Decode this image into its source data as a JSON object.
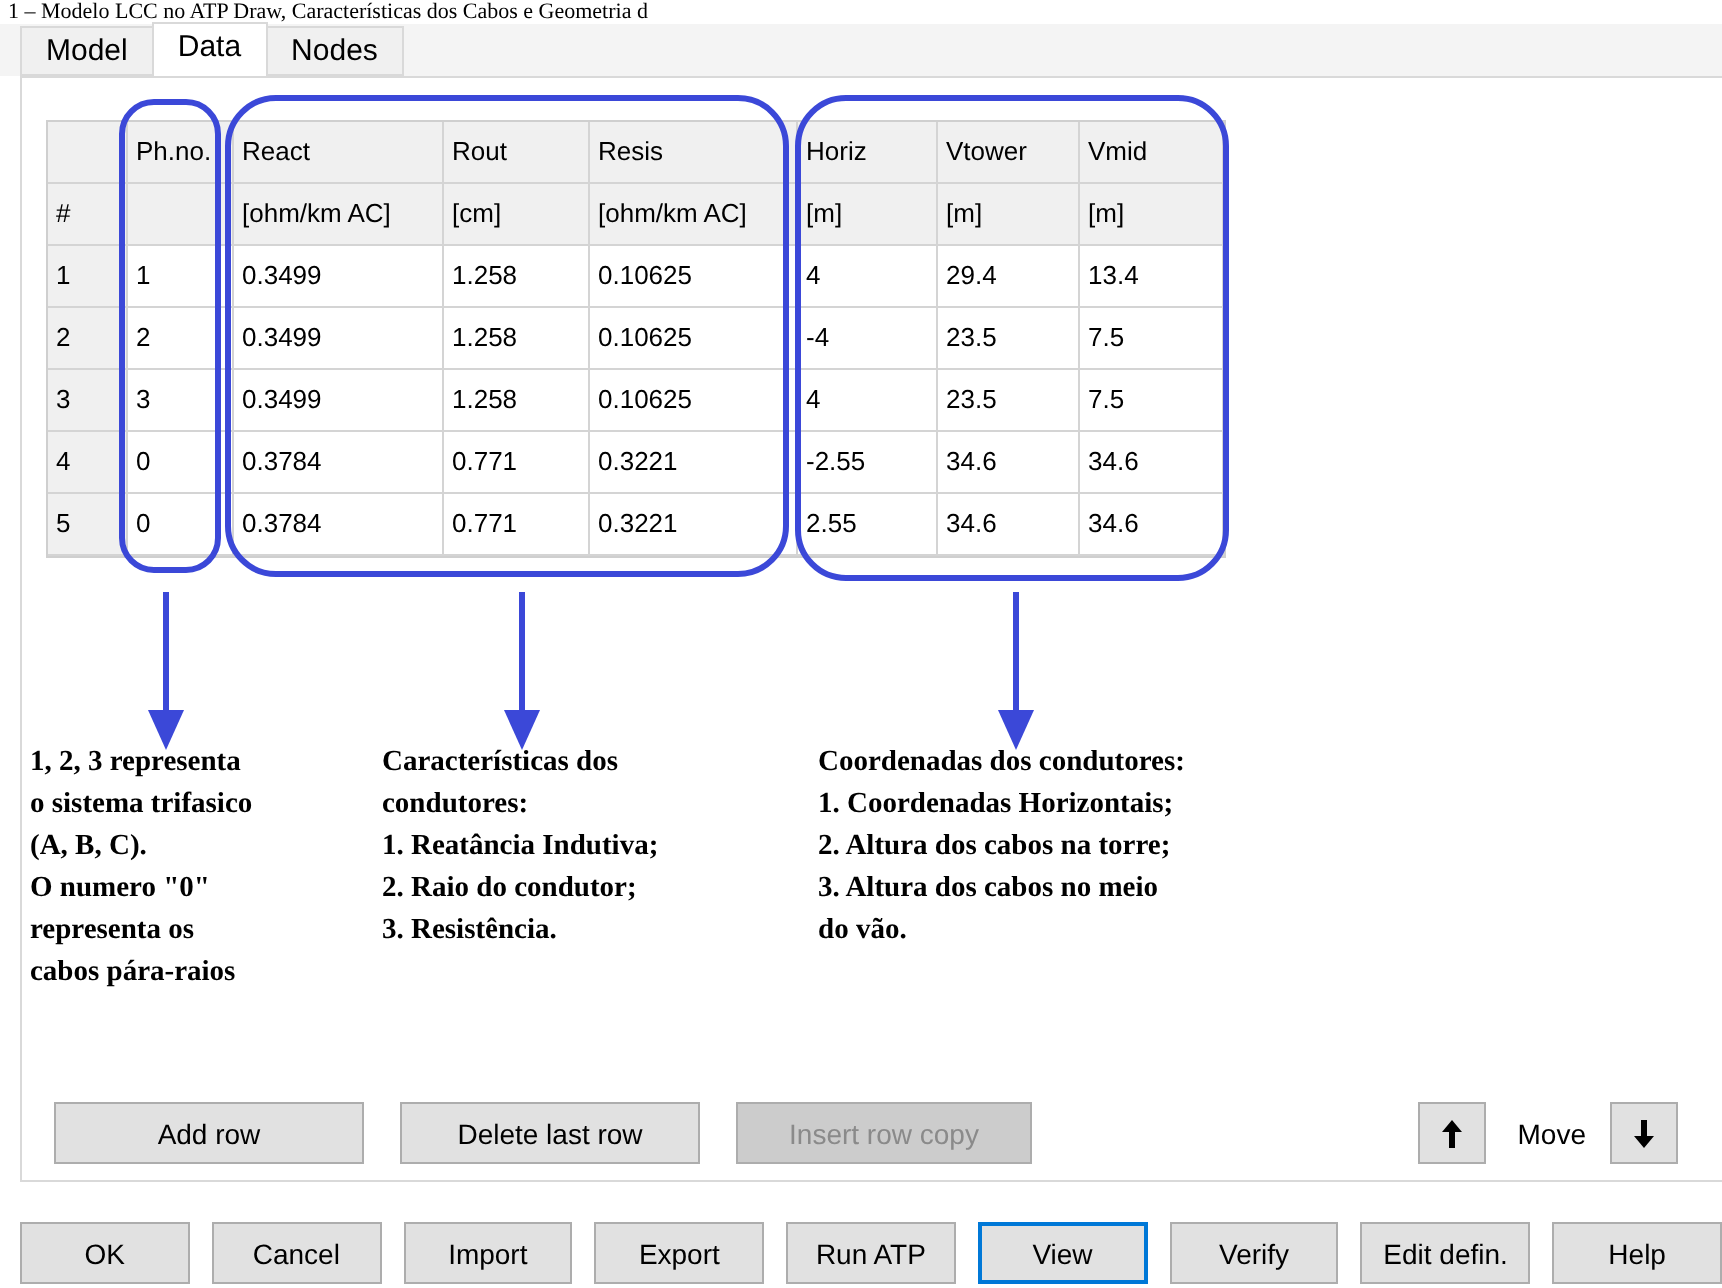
{
  "caption": "1 – Modelo LCC no ATP Draw, Características dos Cabos e Geometria d",
  "tabs": [
    {
      "label": "Model",
      "selected": false
    },
    {
      "label": "Data",
      "selected": true
    },
    {
      "label": "Nodes",
      "selected": false
    }
  ],
  "table": {
    "columns": [
      {
        "subheading": "#"
      },
      {
        "name": "Ph.no."
      },
      {
        "name": "React",
        "subheading": "[ohm/km AC]"
      },
      {
        "name": "Rout",
        "subheading": "[cm]"
      },
      {
        "name": "Resis",
        "subheading": "[ohm/km AC]"
      },
      {
        "name": "Horiz",
        "subheading": "[m]"
      },
      {
        "name": "Vtower",
        "subheading": "[m]"
      },
      {
        "name": "Vmid",
        "subheading": "[m]"
      }
    ],
    "rows": [
      [
        "1",
        "1",
        "0.3499",
        "1.258",
        "0.10625",
        "4",
        "29.4",
        "13.4"
      ],
      [
        "2",
        "2",
        "0.3499",
        "1.258",
        "0.10625",
        "-4",
        "23.5",
        "7.5"
      ],
      [
        "3",
        "3",
        "0.3499",
        "1.258",
        "0.10625",
        "4",
        "23.5",
        "7.5"
      ],
      [
        "4",
        "0",
        "0.3784",
        "0.771",
        "0.3221",
        "-2.55",
        "34.6",
        "34.6"
      ],
      [
        "5",
        "0",
        "0.3784",
        "0.771",
        "0.3221",
        "2.55",
        "34.6",
        "34.6"
      ]
    ]
  },
  "annotations": [
    {
      "lines": [
        "1, 2, 3 representa",
        "o sistema trifasico",
        "(A, B, C).",
        "O numero \"0\"",
        "representa os",
        "cabos pára-raios"
      ]
    },
    {
      "lines": [
        "Características dos",
        "condutores:",
        "1. Reatância Indutiva;",
        "2. Raio do condutor;",
        "3. Resistência."
      ]
    },
    {
      "lines": [
        "Coordenadas dos condutores:",
        "1. Coordenadas Horizontais;",
        "2. Altura dos cabos na torre;",
        "3. Altura dos cabos no meio",
        "do vão."
      ]
    }
  ],
  "row_buttons": [
    {
      "label": "Add row",
      "disabled": false
    },
    {
      "label": "Delete last row",
      "disabled": false
    },
    {
      "label": "Insert row copy",
      "disabled": true
    }
  ],
  "move_label": "Move",
  "footer_buttons": [
    {
      "label": "OK",
      "focused": false
    },
    {
      "label": "Cancel",
      "focused": false
    },
    {
      "label": "Import",
      "focused": false
    },
    {
      "label": "Export",
      "focused": false
    },
    {
      "label": "Run ATP",
      "focused": false
    },
    {
      "label": "View",
      "focused": true
    },
    {
      "label": "Verify",
      "focused": false
    },
    {
      "label": "Edit defin.",
      "focused": false
    },
    {
      "label": "Help",
      "focused": false
    }
  ]
}
